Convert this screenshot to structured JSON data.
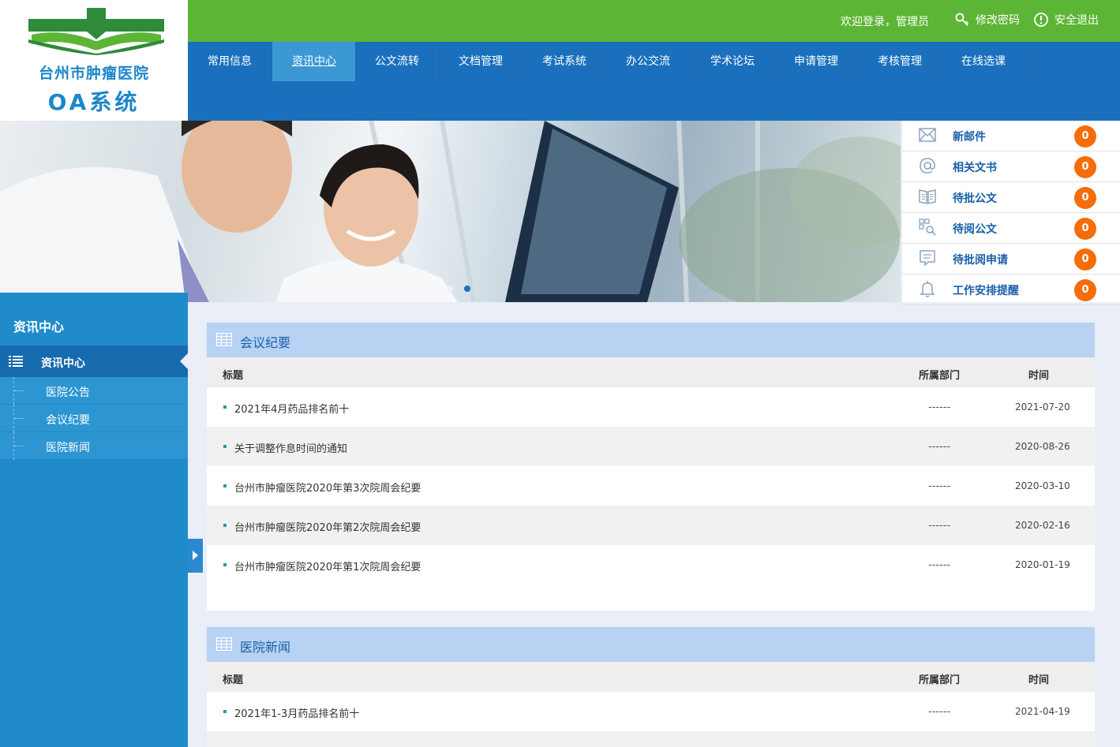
{
  "logo": {
    "name": "台州市肿瘤医院",
    "system": "OA系统"
  },
  "topbar": {
    "welcome": "欢迎登录，管理员",
    "change_password": "修改密码",
    "logout": "安全退出"
  },
  "nav": {
    "items": [
      {
        "label": "常用信息"
      },
      {
        "label": "资讯中心"
      },
      {
        "label": "公文流转"
      },
      {
        "label": "文档管理"
      },
      {
        "label": "考试系统"
      },
      {
        "label": "办公交流"
      },
      {
        "label": "学术论坛"
      },
      {
        "label": "申请管理"
      },
      {
        "label": "考核管理"
      },
      {
        "label": "在线选课"
      }
    ],
    "active": "资讯中心"
  },
  "quick": {
    "items": [
      {
        "label": "新邮件",
        "count": "0",
        "icon": "envelope-icon"
      },
      {
        "label": "相关文书",
        "count": "0",
        "icon": "at-icon"
      },
      {
        "label": "待批公文",
        "count": "0",
        "icon": "book-icon"
      },
      {
        "label": "待阅公文",
        "count": "0",
        "icon": "search-doc-icon"
      },
      {
        "label": "待批阅申请",
        "count": "0",
        "icon": "message-icon"
      },
      {
        "label": "工作安排提醒",
        "count": "0",
        "icon": "bell-icon"
      }
    ],
    "badge_color": "#f56c0a"
  },
  "sidebar": {
    "title": "资讯中心",
    "head": "资讯中心",
    "items": [
      {
        "label": "医院公告"
      },
      {
        "label": "会议纪要"
      },
      {
        "label": "医院新闻"
      }
    ]
  },
  "panels": [
    {
      "title": "会议纪要",
      "columns": {
        "title": "标题",
        "dept": "所属部门",
        "date": "时间"
      },
      "rows": [
        {
          "title": "2021年4月药品排名前十",
          "dept": "------",
          "date": "2021-07-20"
        },
        {
          "title": "关于调整作息时间的通知",
          "dept": "------",
          "date": "2020-08-26"
        },
        {
          "title": "台州市肿瘤医院2020年第3次院周会纪要",
          "dept": "------",
          "date": "2020-03-10"
        },
        {
          "title": "台州市肿瘤医院2020年第2次院周会纪要",
          "dept": "------",
          "date": "2020-02-16"
        },
        {
          "title": "台州市肿瘤医院2020年第1次院周会纪要",
          "dept": "------",
          "date": "2020-01-19"
        }
      ]
    },
    {
      "title": "医院新闻",
      "columns": {
        "title": "标题",
        "dept": "所属部门",
        "date": "时间"
      },
      "rows": [
        {
          "title": "2021年1-3月药品排名前十",
          "dept": "------",
          "date": "2021-04-19"
        }
      ]
    }
  ],
  "colors": {
    "topbar_green": "#5db536",
    "nav_blue": "#1a70bd",
    "sidebar_blue": "#1f8bcb",
    "panel_head": "#b7d2f2"
  }
}
